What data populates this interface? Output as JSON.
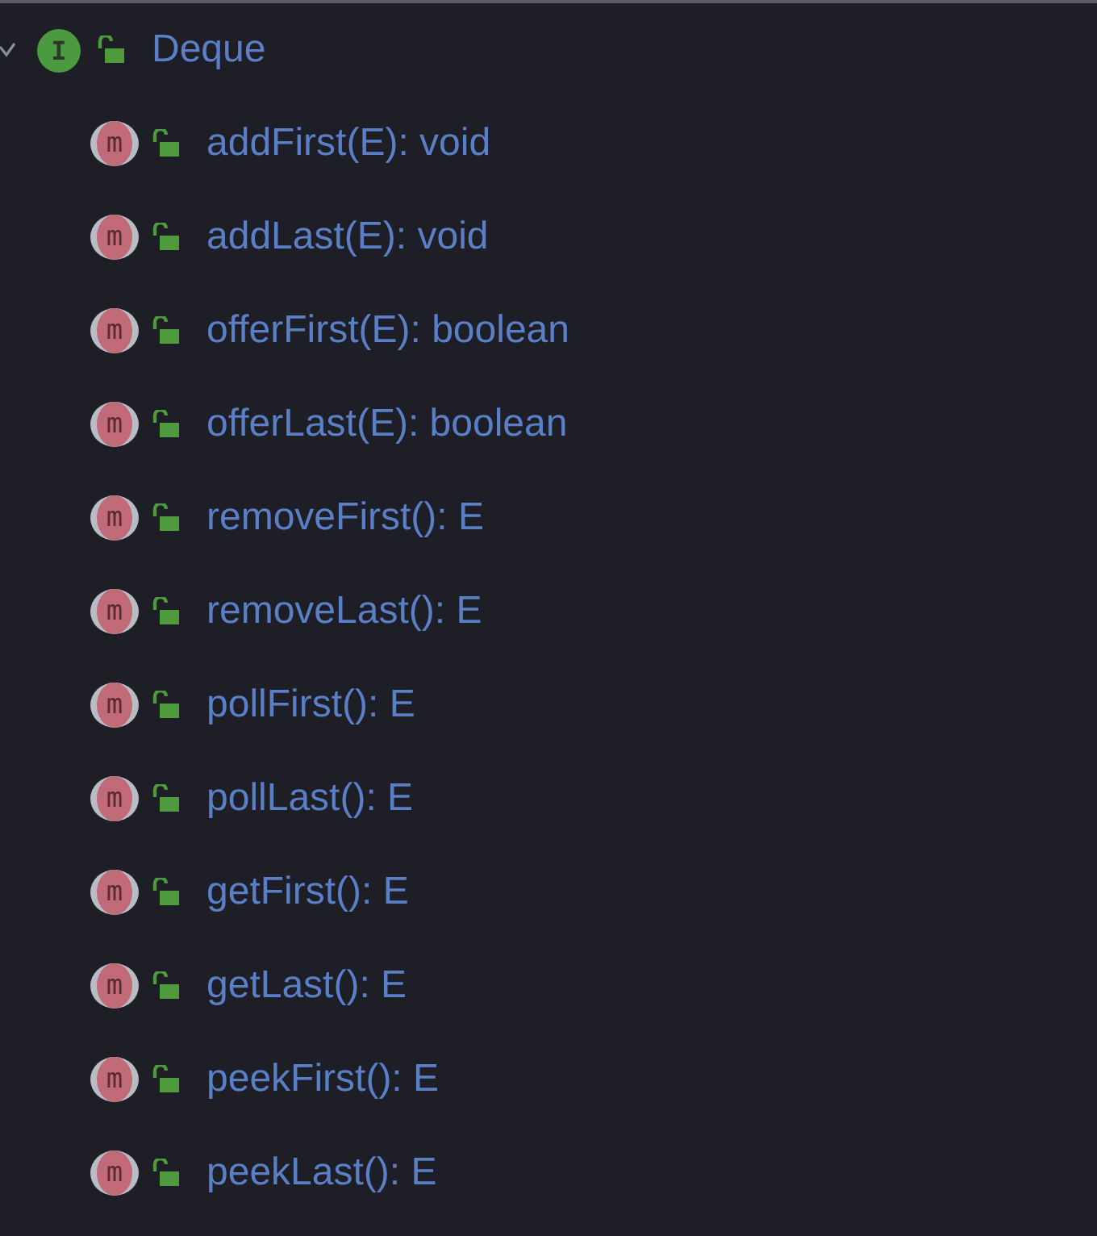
{
  "tree": {
    "label": "Deque",
    "kind": "interface",
    "badge": "I",
    "expanded": true,
    "children": [
      {
        "label": "addFirst(E): void",
        "kind": "method",
        "badge": "m"
      },
      {
        "label": "addLast(E): void",
        "kind": "method",
        "badge": "m"
      },
      {
        "label": "offerFirst(E): boolean",
        "kind": "method",
        "badge": "m"
      },
      {
        "label": "offerLast(E): boolean",
        "kind": "method",
        "badge": "m"
      },
      {
        "label": "removeFirst(): E",
        "kind": "method",
        "badge": "m"
      },
      {
        "label": "removeLast(): E",
        "kind": "method",
        "badge": "m"
      },
      {
        "label": "pollFirst(): E",
        "kind": "method",
        "badge": "m"
      },
      {
        "label": "pollLast(): E",
        "kind": "method",
        "badge": "m"
      },
      {
        "label": "getFirst(): E",
        "kind": "method",
        "badge": "m"
      },
      {
        "label": "getLast(): E",
        "kind": "method",
        "badge": "m"
      },
      {
        "label": "peekFirst(): E",
        "kind": "method",
        "badge": "m"
      },
      {
        "label": "peekLast(): E",
        "kind": "method",
        "badge": "m"
      }
    ]
  }
}
